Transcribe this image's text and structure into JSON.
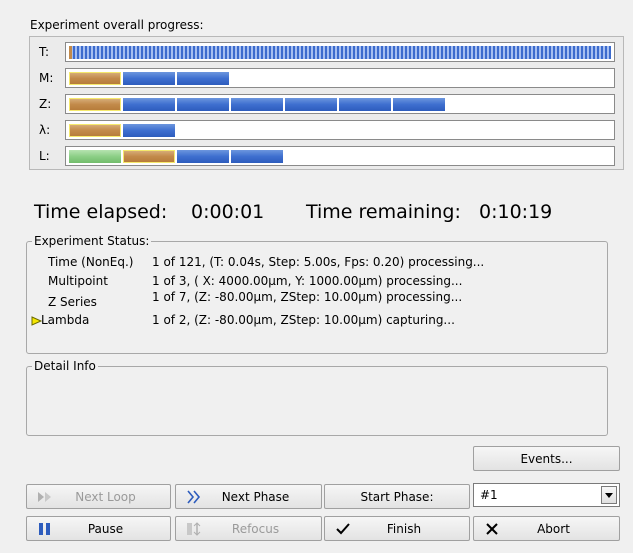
{
  "progress": {
    "title": "Experiment overall progress:",
    "rows": [
      {
        "label": "T:"
      },
      {
        "label": "M:"
      },
      {
        "label": "Z:"
      },
      {
        "label": "λ:"
      },
      {
        "label": "L:"
      }
    ]
  },
  "time": {
    "elapsed_label": "Time elapsed:",
    "elapsed_value": "0:00:01",
    "remaining_label": "Time remaining:",
    "remaining_value": "0:10:19"
  },
  "status": {
    "title": "Experiment Status:",
    "rows": [
      {
        "name": "Time (NonEq.)",
        "value": "1 of 121, (T: 0.04s, Step: 5.00s, Fps: 0.20) processing..."
      },
      {
        "name": "Multipoint",
        "value": "1 of 3, ( X: 4000.00µm, Y: 1000.00µm) processing..."
      },
      {
        "name": "Z Series",
        "value": "1 of 7, (Z: -80.00µm, ZStep: 10.00µm) processing..."
      },
      {
        "name": "Lambda",
        "value": "1 of 2, (Z: -80.00µm, ZStep: 10.00µm) capturing..."
      }
    ]
  },
  "detail": {
    "title": "Detail Info"
  },
  "buttons": {
    "events": "Events...",
    "next_loop": "Next Loop",
    "next_phase": "Next Phase",
    "start_phase": "Start Phase:",
    "pause": "Pause",
    "refocus": "Refocus",
    "finish": "Finish",
    "abort": "Abort"
  },
  "phase_select": {
    "value": "#1"
  },
  "colors": {
    "completed": "#c28a4a",
    "pending": "#3e6fcf",
    "green": "#8ccf86",
    "current_marker": "#f5e600"
  },
  "icons": {
    "next_loop": "fast-forward-icon",
    "next_phase": "chevron-double-right-icon",
    "pause": "pause-icon",
    "refocus": "refocus-icon",
    "finish": "checkmark-icon",
    "abort": "x-icon",
    "current": "triangle-right-icon"
  }
}
